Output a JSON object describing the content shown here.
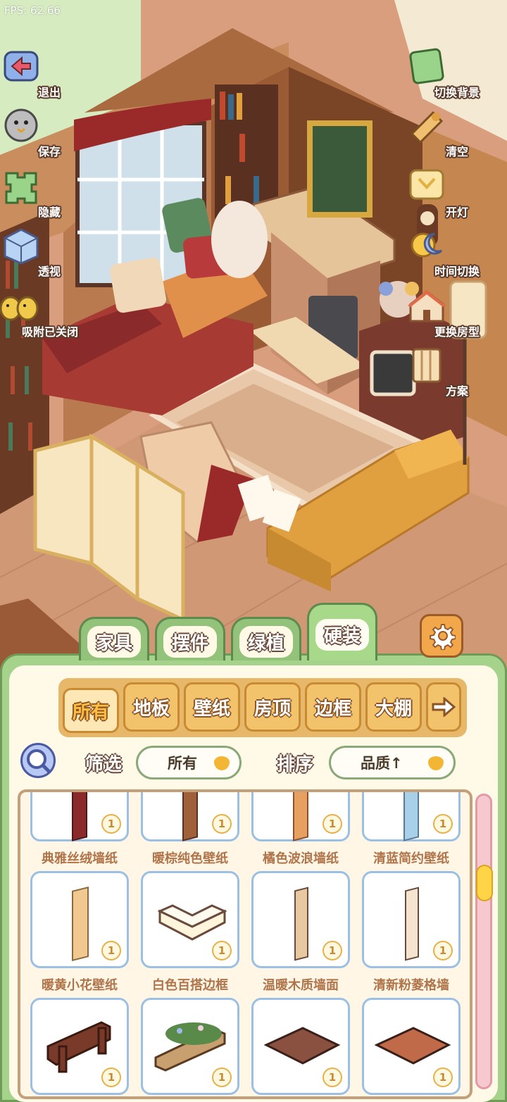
{
  "fps": "FPS: 62.66",
  "side_left": [
    {
      "label": "退出",
      "icon": "exit-icon"
    },
    {
      "label": "保存",
      "icon": "save-icon"
    },
    {
      "label": "隐藏",
      "icon": "hide-icon"
    },
    {
      "label": "透视",
      "icon": "perspective-icon"
    },
    {
      "label": "吸附已关闭",
      "icon": "snap-icon"
    }
  ],
  "side_right": [
    {
      "label": "切换背景",
      "icon": "background-icon"
    },
    {
      "label": "清空",
      "icon": "clear-icon"
    },
    {
      "label": "开灯",
      "icon": "light-icon"
    },
    {
      "label": "时间切换",
      "icon": "time-icon"
    },
    {
      "label": "更换房型",
      "icon": "house-icon"
    },
    {
      "label": "方案",
      "icon": "plan-icon"
    }
  ],
  "category_tabs": [
    "家具",
    "摆件",
    "绿植",
    "硬装"
  ],
  "active_category": "硬装",
  "sub_tabs": [
    "所有",
    "地板",
    "壁纸",
    "房顶",
    "边框",
    "大棚"
  ],
  "active_sub_tab": "所有",
  "filter": {
    "label": "筛选",
    "value": "所有"
  },
  "sort": {
    "label": "排序",
    "value": "品质↑"
  },
  "items": [
    {
      "name": "典雅丝绒墙纸",
      "count": "1",
      "color": "#8a2a2a"
    },
    {
      "name": "暖棕纯色壁纸",
      "count": "1",
      "color": "#a0603a"
    },
    {
      "name": "橘色波浪墙纸",
      "count": "1",
      "color": "#e8a060"
    },
    {
      "name": "清蓝简约壁纸",
      "count": "1",
      "color": "#a8d0e8"
    },
    {
      "name": "暖黄小花壁纸",
      "count": "1",
      "color": "#f0c890"
    },
    {
      "name": "白色百搭边框",
      "count": "1",
      "color": "#fff4dc"
    },
    {
      "name": "温暖木质墙面",
      "count": "1",
      "color": "#e8c8a0"
    },
    {
      "name": "清新粉菱格墙",
      "count": "1",
      "color": "#f4e4d0"
    },
    {
      "name": "",
      "count": "1",
      "color": "#7a3a2a"
    },
    {
      "name": "",
      "count": "1",
      "color": "#5a8a4a"
    },
    {
      "name": "",
      "count": "1",
      "color": "#8a5040"
    },
    {
      "name": "",
      "count": "1",
      "color": "#c06a4a"
    }
  ]
}
